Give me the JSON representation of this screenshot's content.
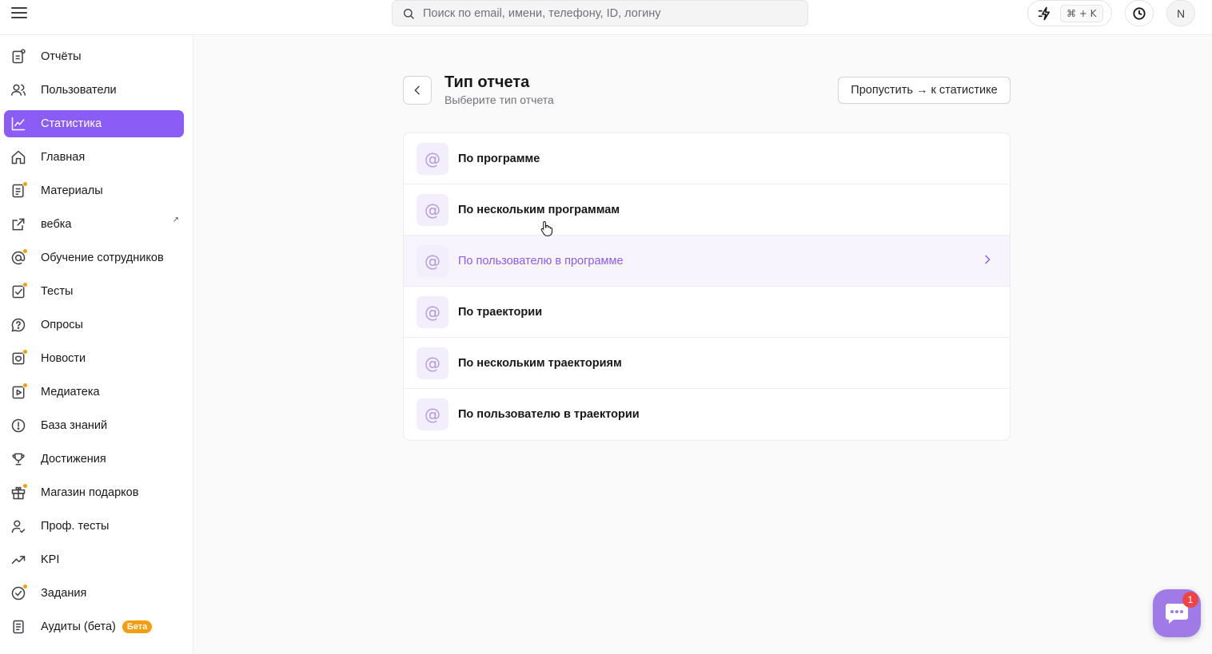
{
  "search": {
    "placeholder": "Поиск по email, имени, телефону, ID, логину"
  },
  "topbar": {
    "shortcut": "⌘ + K",
    "avatar_initial": "N"
  },
  "sidebar": {
    "items": [
      {
        "label": "Отчёты",
        "icon": "reports-icon"
      },
      {
        "label": "Пользователи",
        "icon": "users-icon"
      },
      {
        "label": "Статистика",
        "icon": "chart-line-icon",
        "active": true
      },
      {
        "label": "Главная",
        "icon": "home-icon"
      },
      {
        "label": "Материалы",
        "icon": "materials-icon"
      },
      {
        "label": "вебка",
        "icon": "external-link-icon"
      },
      {
        "label": "Обучение сотрудников",
        "icon": "training-icon"
      },
      {
        "label": "Тесты",
        "icon": "tests-icon"
      },
      {
        "label": "Опросы",
        "icon": "survey-icon"
      },
      {
        "label": "Новости",
        "icon": "news-icon"
      },
      {
        "label": "Медиатека",
        "icon": "media-icon"
      },
      {
        "label": "База знаний",
        "icon": "knowledge-icon"
      },
      {
        "label": "Достижения",
        "icon": "trophy-icon"
      },
      {
        "label": "Магазин подарков",
        "icon": "gift-icon"
      },
      {
        "label": "Проф. тесты",
        "icon": "prof-tests-icon"
      },
      {
        "label": "KPI",
        "icon": "kpi-icon"
      },
      {
        "label": "Задания",
        "icon": "tasks-icon"
      },
      {
        "label": "Аудиты (бета)",
        "icon": "audit-icon",
        "badge": "Бета"
      }
    ],
    "ext_arrow": "↗"
  },
  "main": {
    "title": "Тип отчета",
    "subtitle": "Выберите тип отчета",
    "skip_label": "Пропустить → к статистике",
    "options": [
      {
        "label": "По программе",
        "icon": "at-icon"
      },
      {
        "label": "По нескольким программам",
        "icon": "at-icon"
      },
      {
        "label": "По пользователю в программе",
        "icon": "at-icon",
        "hovered": true
      },
      {
        "label": "По траектории",
        "icon": "at-icon"
      },
      {
        "label": "По нескольким траекториям",
        "icon": "at-icon"
      },
      {
        "label": "По пользователю в траектории",
        "icon": "at-icon"
      }
    ],
    "option_glyph": "@"
  },
  "chat": {
    "badge": "1"
  },
  "colors": {
    "accent": "#8b5cf6",
    "dot": "#f59e0b",
    "badge_red": "#ef4444"
  }
}
